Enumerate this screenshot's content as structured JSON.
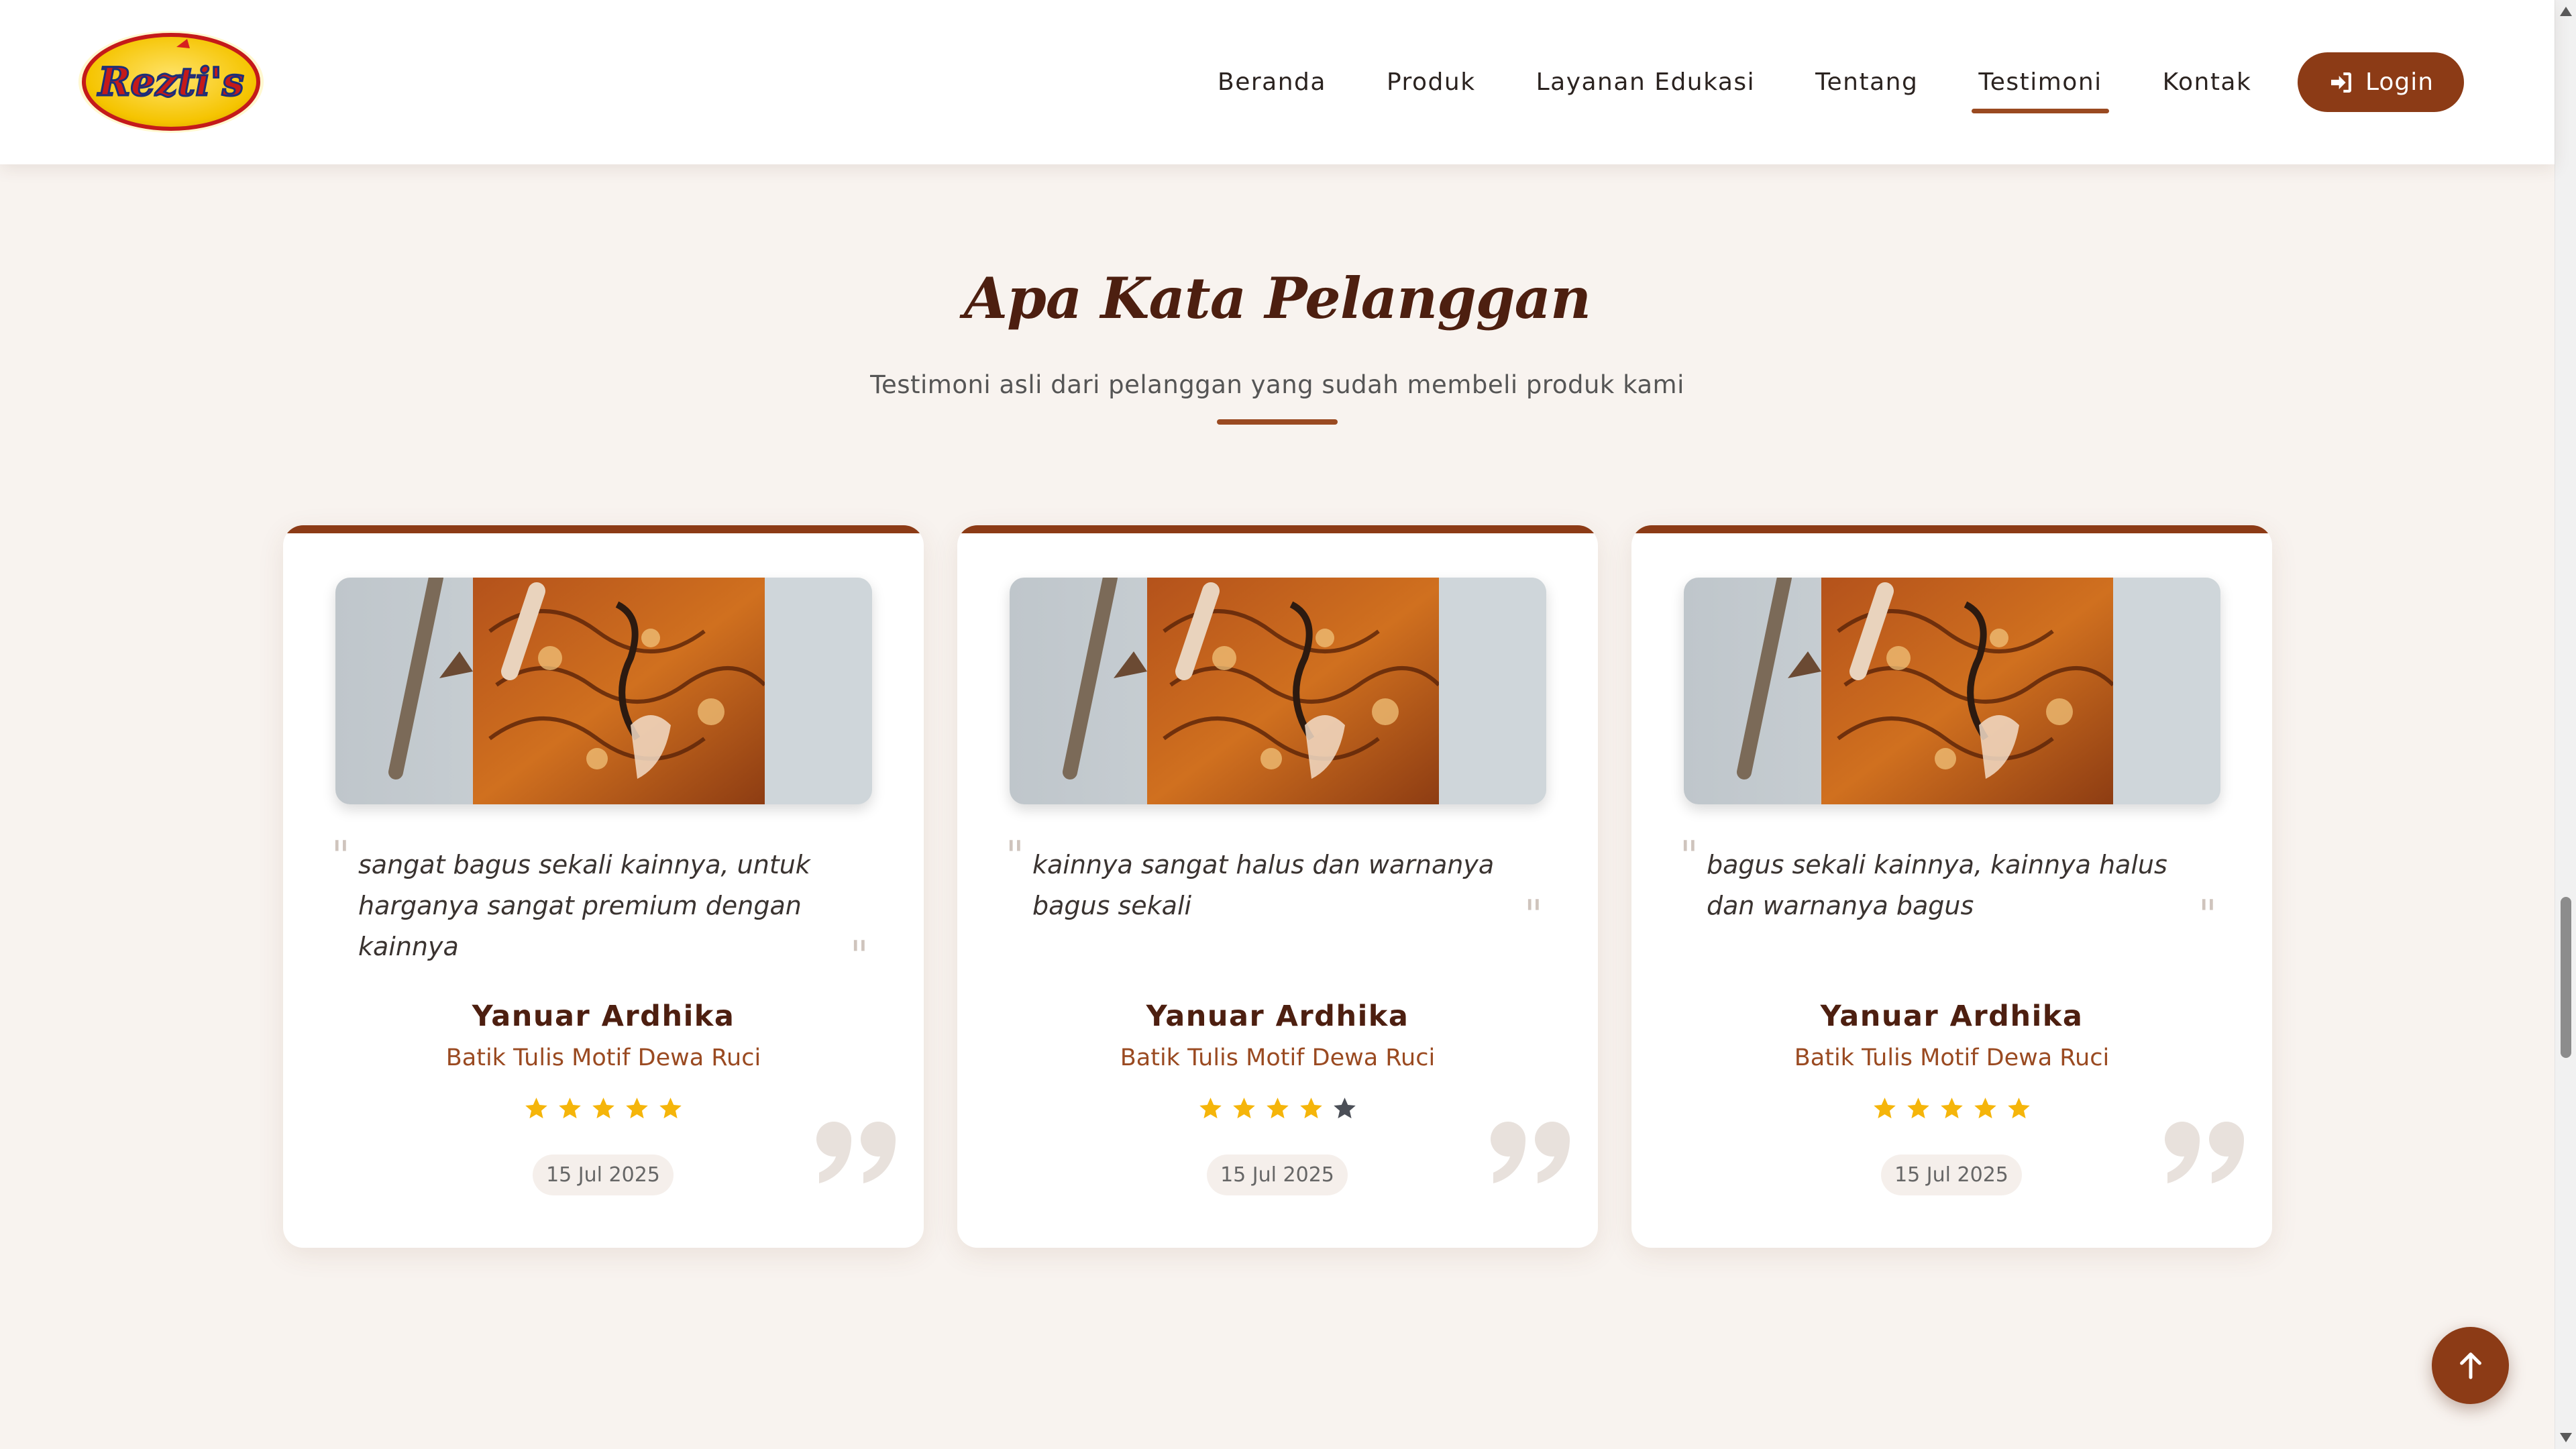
{
  "brand": {
    "logo_text": "Rezti's"
  },
  "nav": {
    "items": [
      {
        "label": "Beranda",
        "active": false
      },
      {
        "label": "Produk",
        "active": false
      },
      {
        "label": "Layanan Edukasi",
        "active": false
      },
      {
        "label": "Tentang",
        "active": false
      },
      {
        "label": "Testimoni",
        "active": true
      },
      {
        "label": "Kontak",
        "active": false
      }
    ],
    "login_label": "Login"
  },
  "section": {
    "title": "Apa Kata Pelanggan",
    "subtitle": "Testimoni asli dari pelanggan yang sudah membeli produk kami"
  },
  "testimonials": [
    {
      "quote": "sangat bagus sekali kainnya, untuk harganya sangat premium dengan kainnya",
      "name": "Yanuar Ardhika",
      "product": "Batik Tulis Motif Dewa Ruci",
      "rating": 5,
      "date": "15 Jul 2025"
    },
    {
      "quote": "kainnya sangat halus dan warnanya bagus sekali",
      "name": "Yanuar Ardhika",
      "product": "Batik Tulis Motif Dewa Ruci",
      "rating": 4,
      "date": "15 Jul 2025"
    },
    {
      "quote": "bagus sekali kainnya, kainnya halus dan warnanya bagus",
      "name": "Yanuar Ardhika",
      "product": "Batik Tulis Motif Dewa Ruci",
      "rating": 5,
      "date": "15 Jul 2025"
    }
  ],
  "icons": {
    "login": "sign-in-icon",
    "star": "star-icon",
    "quote": "quote-icon",
    "back_to_top": "arrow-up-icon"
  },
  "colors": {
    "brand_brown": "#8c3b16",
    "accent_brown": "#9a4a21",
    "heading": "#4d1f10",
    "star_filled": "#f5b50a",
    "star_empty": "#4b4f57",
    "page_bg": "#f8f3ef"
  }
}
